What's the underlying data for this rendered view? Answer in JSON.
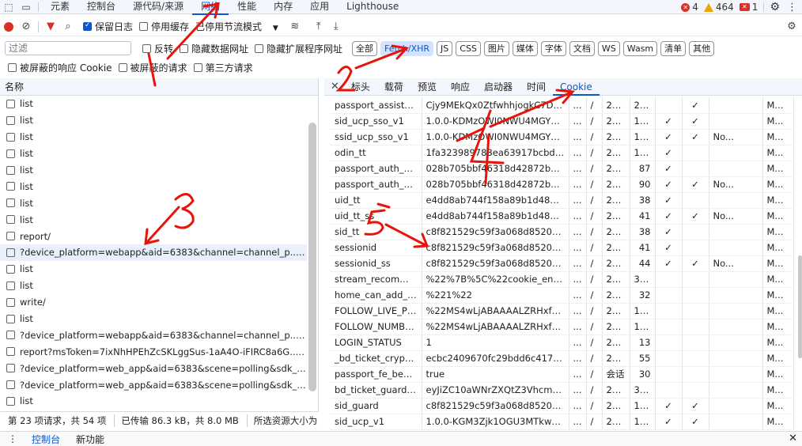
{
  "top": {
    "tabs": [
      "元素",
      "控制台",
      "源代码/来源",
      "网络",
      "性能",
      "内存",
      "应用",
      "Lighthouse"
    ],
    "active_tab": 3,
    "errors": "4",
    "warnings": "464",
    "issues": "1"
  },
  "toolbar": {
    "preserve_log": "保留日志",
    "disable_cache": "停用缓存",
    "throttle": "已停用节流模式"
  },
  "filter": {
    "placeholder": "过滤",
    "invert": "反转",
    "hide_data_urls": "隐藏数据网址",
    "hide_ext_urls": "隐藏扩展程序网址",
    "chips": [
      "全部",
      "Fetch/XHR",
      "JS",
      "CSS",
      "图片",
      "媒体",
      "字体",
      "文档",
      "WS",
      "Wasm",
      "清单",
      "其他"
    ],
    "active_chip": 1,
    "blocked_cookies": "被屏蔽的响应 Cookie",
    "blocked_requests": "被屏蔽的请求",
    "third_party": "第三方请求"
  },
  "requests": {
    "header": "名称",
    "rows": [
      "list",
      "list",
      "list",
      "list",
      "list",
      "list",
      "list",
      "list",
      "report/",
      "?device_platform=webapp&aid=6383&channel=channel_p...GKM...",
      "list",
      "list",
      "write/",
      "list",
      "?device_platform=webapp&aid=6383&channel=channel_p...GKM...",
      "report?msToken=7ixNhHPEhZcSKLggSus-1aA4O-iFIRC8a6G...GKM...",
      "?device_platform=web_app&aid=6383&scene=polling&sdk_versio...",
      "?device_platform=web_app&aid=6383&scene=polling&sdk_versio...",
      "list"
    ],
    "selected": 9
  },
  "status": {
    "requests": "第 23 项请求，共 54 项",
    "transferred": "已传输 86.3 kB，共 8.0 MB",
    "resources": "所选资源大小为"
  },
  "detail": {
    "tabs": [
      "标头",
      "载荷",
      "预览",
      "响应",
      "启动器",
      "时间",
      "Cookie"
    ],
    "active_tab": 6,
    "cookies": [
      {
        "name": "passport_assist_us...",
        "value": "Cjy9MEkQx0ZtfwhhjogkC7DO...",
        "d": "...",
        "p": "/",
        "e": "20...",
        "s": "220",
        "h": "",
        "sec": "✓",
        "ss": "",
        "pr": "M..."
      },
      {
        "name": "sid_ucp_sso_v1",
        "value": "1.0.0-KDMzOWI0NWU4MGYzY...",
        "d": "...",
        "p": "/",
        "e": "20...",
        "s": "167",
        "h": "✓",
        "sec": "✓",
        "ss": "",
        "pr": "M..."
      },
      {
        "name": "ssid_ucp_sso_v1",
        "value": "1.0.0-KDMzOWI0NWU4MGYzY...",
        "d": "...",
        "p": "/",
        "e": "20...",
        "s": "168",
        "h": "✓",
        "sec": "✓",
        "ss": "No...",
        "pr": "M..."
      },
      {
        "name": "odin_tt",
        "value": "1fa323989783ea63917bcbd33...",
        "d": "...",
        "p": "/",
        "e": "20...",
        "s": "103",
        "h": "✓",
        "sec": "",
        "ss": "",
        "pr": "M..."
      },
      {
        "name": "passport_auth_sta...",
        "value": "028b705bbf46318d42872bbade...",
        "d": "...",
        "p": "/",
        "e": "20...",
        "s": "87",
        "h": "✓",
        "sec": "",
        "ss": "",
        "pr": "M..."
      },
      {
        "name": "passport_auth_sta...",
        "value": "028b705bbf46318d42872bbade...",
        "d": "...",
        "p": "/",
        "e": "20...",
        "s": "90",
        "h": "✓",
        "sec": "✓",
        "ss": "No...",
        "pr": "M..."
      },
      {
        "name": "uid_tt",
        "value": "e4dd8ab744f158a89b1d489a07...",
        "d": "...",
        "p": "/",
        "e": "20...",
        "s": "38",
        "h": "✓",
        "sec": "",
        "ss": "",
        "pr": "M..."
      },
      {
        "name": "uid_tt_ss",
        "value": "e4dd8ab744f158a89b1d489a07...",
        "d": "...",
        "p": "/",
        "e": "20...",
        "s": "41",
        "h": "✓",
        "sec": "✓",
        "ss": "No...",
        "pr": "M..."
      },
      {
        "name": "sid_tt",
        "value": "c8f821529c59f3a068d85204fc9f...",
        "d": "...",
        "p": "/",
        "e": "20...",
        "s": "38",
        "h": "✓",
        "sec": "",
        "ss": "",
        "pr": "M..."
      },
      {
        "name": "sessionid",
        "value": "c8f821529c59f3a068d85204fc9f...",
        "d": "...",
        "p": "/",
        "e": "20...",
        "s": "41",
        "h": "✓",
        "sec": "",
        "ss": "",
        "pr": "M..."
      },
      {
        "name": "sessionid_ss",
        "value": "c8f821529c59f3a068d85204fc9f...",
        "d": "...",
        "p": "/",
        "e": "20...",
        "s": "44",
        "h": "✓",
        "sec": "✓",
        "ss": "No...",
        "pr": "M..."
      },
      {
        "name": "stream_recomme...",
        "value": "%22%7B%5C%22cookie_enable...",
        "d": "...",
        "p": "/",
        "e": "20...",
        "s": "352",
        "h": "",
        "sec": "",
        "ss": "",
        "pr": "M..."
      },
      {
        "name": "home_can_add_dy...",
        "value": "%221%22",
        "d": "...",
        "p": "/",
        "e": "20...",
        "s": "32",
        "h": "",
        "sec": "",
        "ss": "",
        "pr": "M..."
      },
      {
        "name": "FOLLOW_LIVE_POI...",
        "value": "%22MS4wLjABAAAALZRHxfhK0...",
        "d": "...",
        "p": "/",
        "e": "20...",
        "s": "123",
        "h": "",
        "sec": "",
        "ss": "",
        "pr": "M..."
      },
      {
        "name": "FOLLOW_NUMBE...",
        "value": "%22MS4wLjABAAAALZRHxfhK0...",
        "d": "...",
        "p": "/",
        "e": "20...",
        "s": "132",
        "h": "",
        "sec": "",
        "ss": "",
        "pr": "M..."
      },
      {
        "name": "LOGIN_STATUS",
        "value": "1",
        "d": "...",
        "p": "/",
        "e": "20...",
        "s": "13",
        "h": "",
        "sec": "",
        "ss": "",
        "pr": "M..."
      },
      {
        "name": "_bd_ticket_crypt_c...",
        "value": "ecbc2409670fc29bdd6c417afb8...",
        "d": "...",
        "p": "/",
        "e": "20...",
        "s": "55",
        "h": "",
        "sec": "",
        "ss": "",
        "pr": "M..."
      },
      {
        "name": "passport_fe_beati...",
        "value": "true",
        "d": "...",
        "p": "/",
        "e": "会话",
        "s": "30",
        "h": "",
        "sec": "",
        "ss": "",
        "pr": "M..."
      },
      {
        "name": "bd_ticket_guard_c...",
        "value": "eyJiZC10aWNrZXQtZ3VhcmQtd...",
        "d": "...",
        "p": "/",
        "e": "20...",
        "s": "331",
        "h": "",
        "sec": "",
        "ss": "",
        "pr": "M..."
      },
      {
        "name": "sid_guard",
        "value": "c8f821529c59f3a068d85204fc9f...",
        "d": "...",
        "p": "/",
        "e": "20...",
        "s": "102",
        "h": "✓",
        "sec": "✓",
        "ss": "",
        "pr": "M..."
      },
      {
        "name": "sid_ucp_v1",
        "value": "1.0.0-KGM3Zjk1OGU3MTkwNTg...",
        "d": "...",
        "p": "/",
        "e": "20...",
        "s": "158",
        "h": "✓",
        "sec": "✓",
        "ss": "",
        "pr": "M..."
      }
    ]
  },
  "bottom": {
    "tabs": [
      "控制台",
      "新功能"
    ]
  },
  "annotations": {
    "labels": [
      "1",
      "2",
      "3",
      "4",
      "5"
    ],
    "color": "#e8140c"
  }
}
